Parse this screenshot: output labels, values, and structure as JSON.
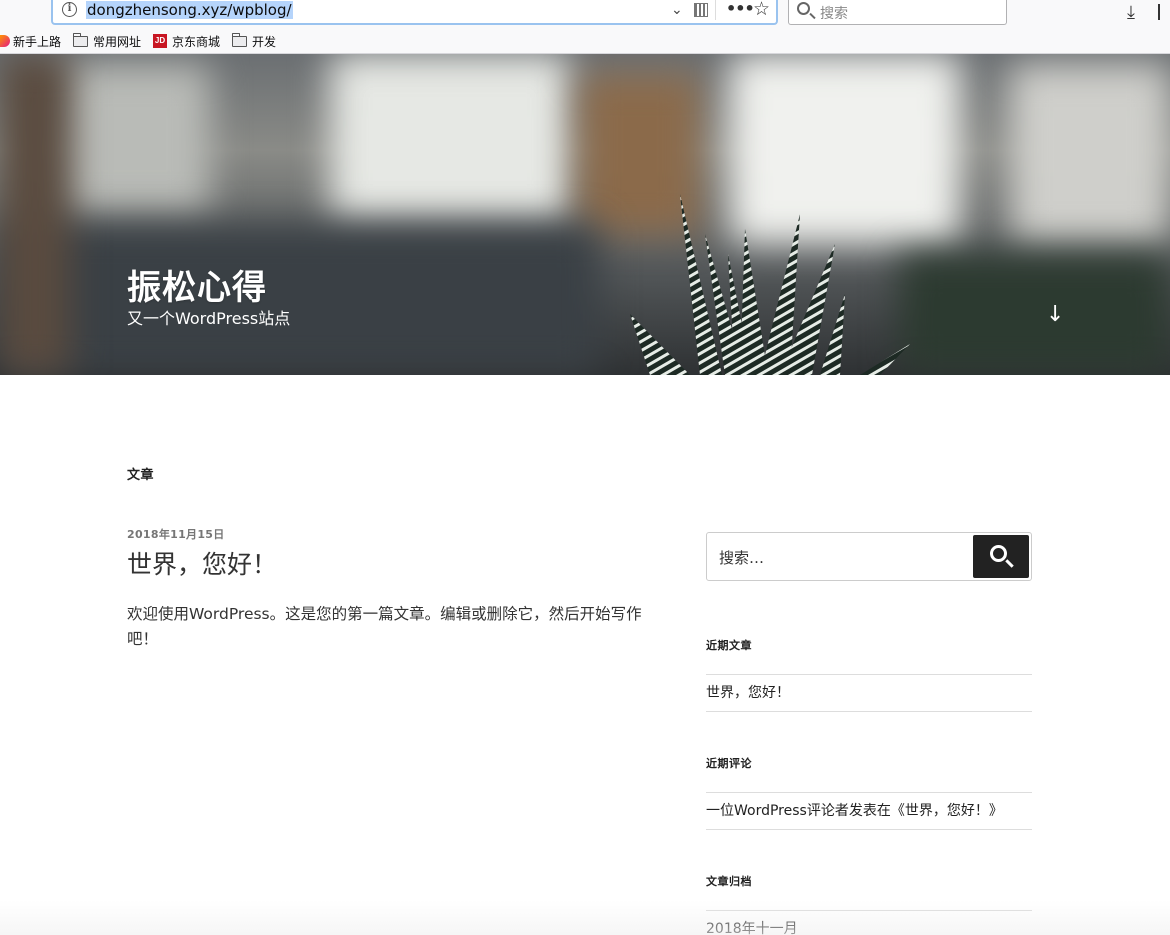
{
  "browser": {
    "url": "dongzhensong.xyz/wpblog/",
    "search_placeholder": "搜索",
    "icons": [
      "info-icon",
      "chevron-down-icon",
      "qr-code-icon",
      "more-icon",
      "star-icon",
      "search-icon",
      "download-icon",
      "library-icon"
    ],
    "bookmarks": [
      {
        "label": "新手上路",
        "icon": "firefox-icon"
      },
      {
        "label": "常用网址",
        "icon": "folder-icon"
      },
      {
        "label": "京东商城",
        "icon": "jd-icon",
        "icon_text": "JD"
      },
      {
        "label": "开发",
        "icon": "folder-icon"
      }
    ]
  },
  "hero": {
    "site_title": "振松心得",
    "site_description": "又一个WordPress站点",
    "scroll_icon": "arrow-down-icon"
  },
  "main": {
    "heading": "文章",
    "post": {
      "date": "2018年11月15日",
      "title": "世界，您好！",
      "body": "欢迎使用WordPress。这是您的第一篇文章。编辑或删除它，然后开始写作吧！"
    }
  },
  "sidebar": {
    "search_placeholder": "搜索…",
    "recent_posts_title": "近期文章",
    "recent_posts": [
      "世界，您好！"
    ],
    "recent_comments_title": "近期评论",
    "recent_comments": [
      "一位WordPress评论者发表在《世界，您好！》"
    ],
    "archives_title": "文章归档",
    "archives": [
      "2018年十一月"
    ]
  },
  "colors": {
    "urlbar_focus": "#9ac3ef",
    "url_highlight": "#b5d4fb",
    "search_button": "#222222",
    "jd_red": "#c81623"
  }
}
